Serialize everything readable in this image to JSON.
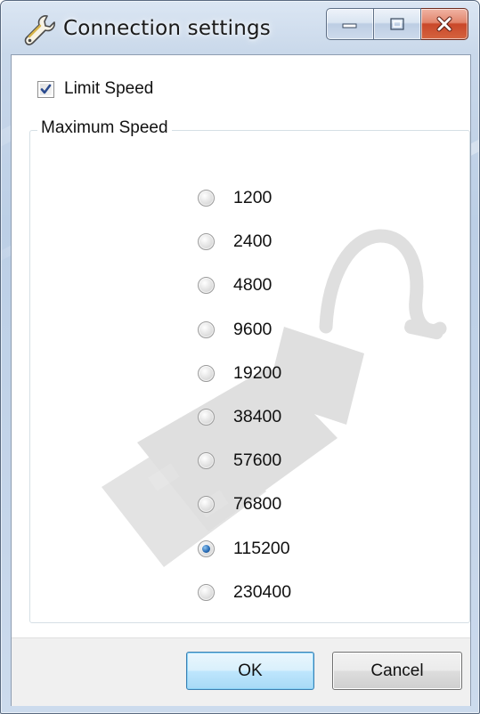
{
  "window": {
    "title": "Connection settings"
  },
  "limit_speed": {
    "label": "Limit Speed",
    "checked": true
  },
  "maximum_speed": {
    "legend": "Maximum Speed",
    "options": [
      "1200",
      "2400",
      "4800",
      "9600",
      "19200",
      "38400",
      "57600",
      "76800",
      "115200",
      "230400"
    ],
    "selected": "115200"
  },
  "buttons": {
    "ok_label": "OK",
    "cancel_label": "Cancel"
  },
  "icons": {
    "title": "wrench-icon",
    "minimize": "minimize-icon",
    "maximize": "maximize-icon",
    "close": "close-icon",
    "watermark": "usb-plug-icon"
  },
  "colors": {
    "frame": "#c9d8ea",
    "close_button": "#c9482a",
    "radio_selected": "#2a6fb8",
    "ok_button_border": "#3c7fb1"
  }
}
